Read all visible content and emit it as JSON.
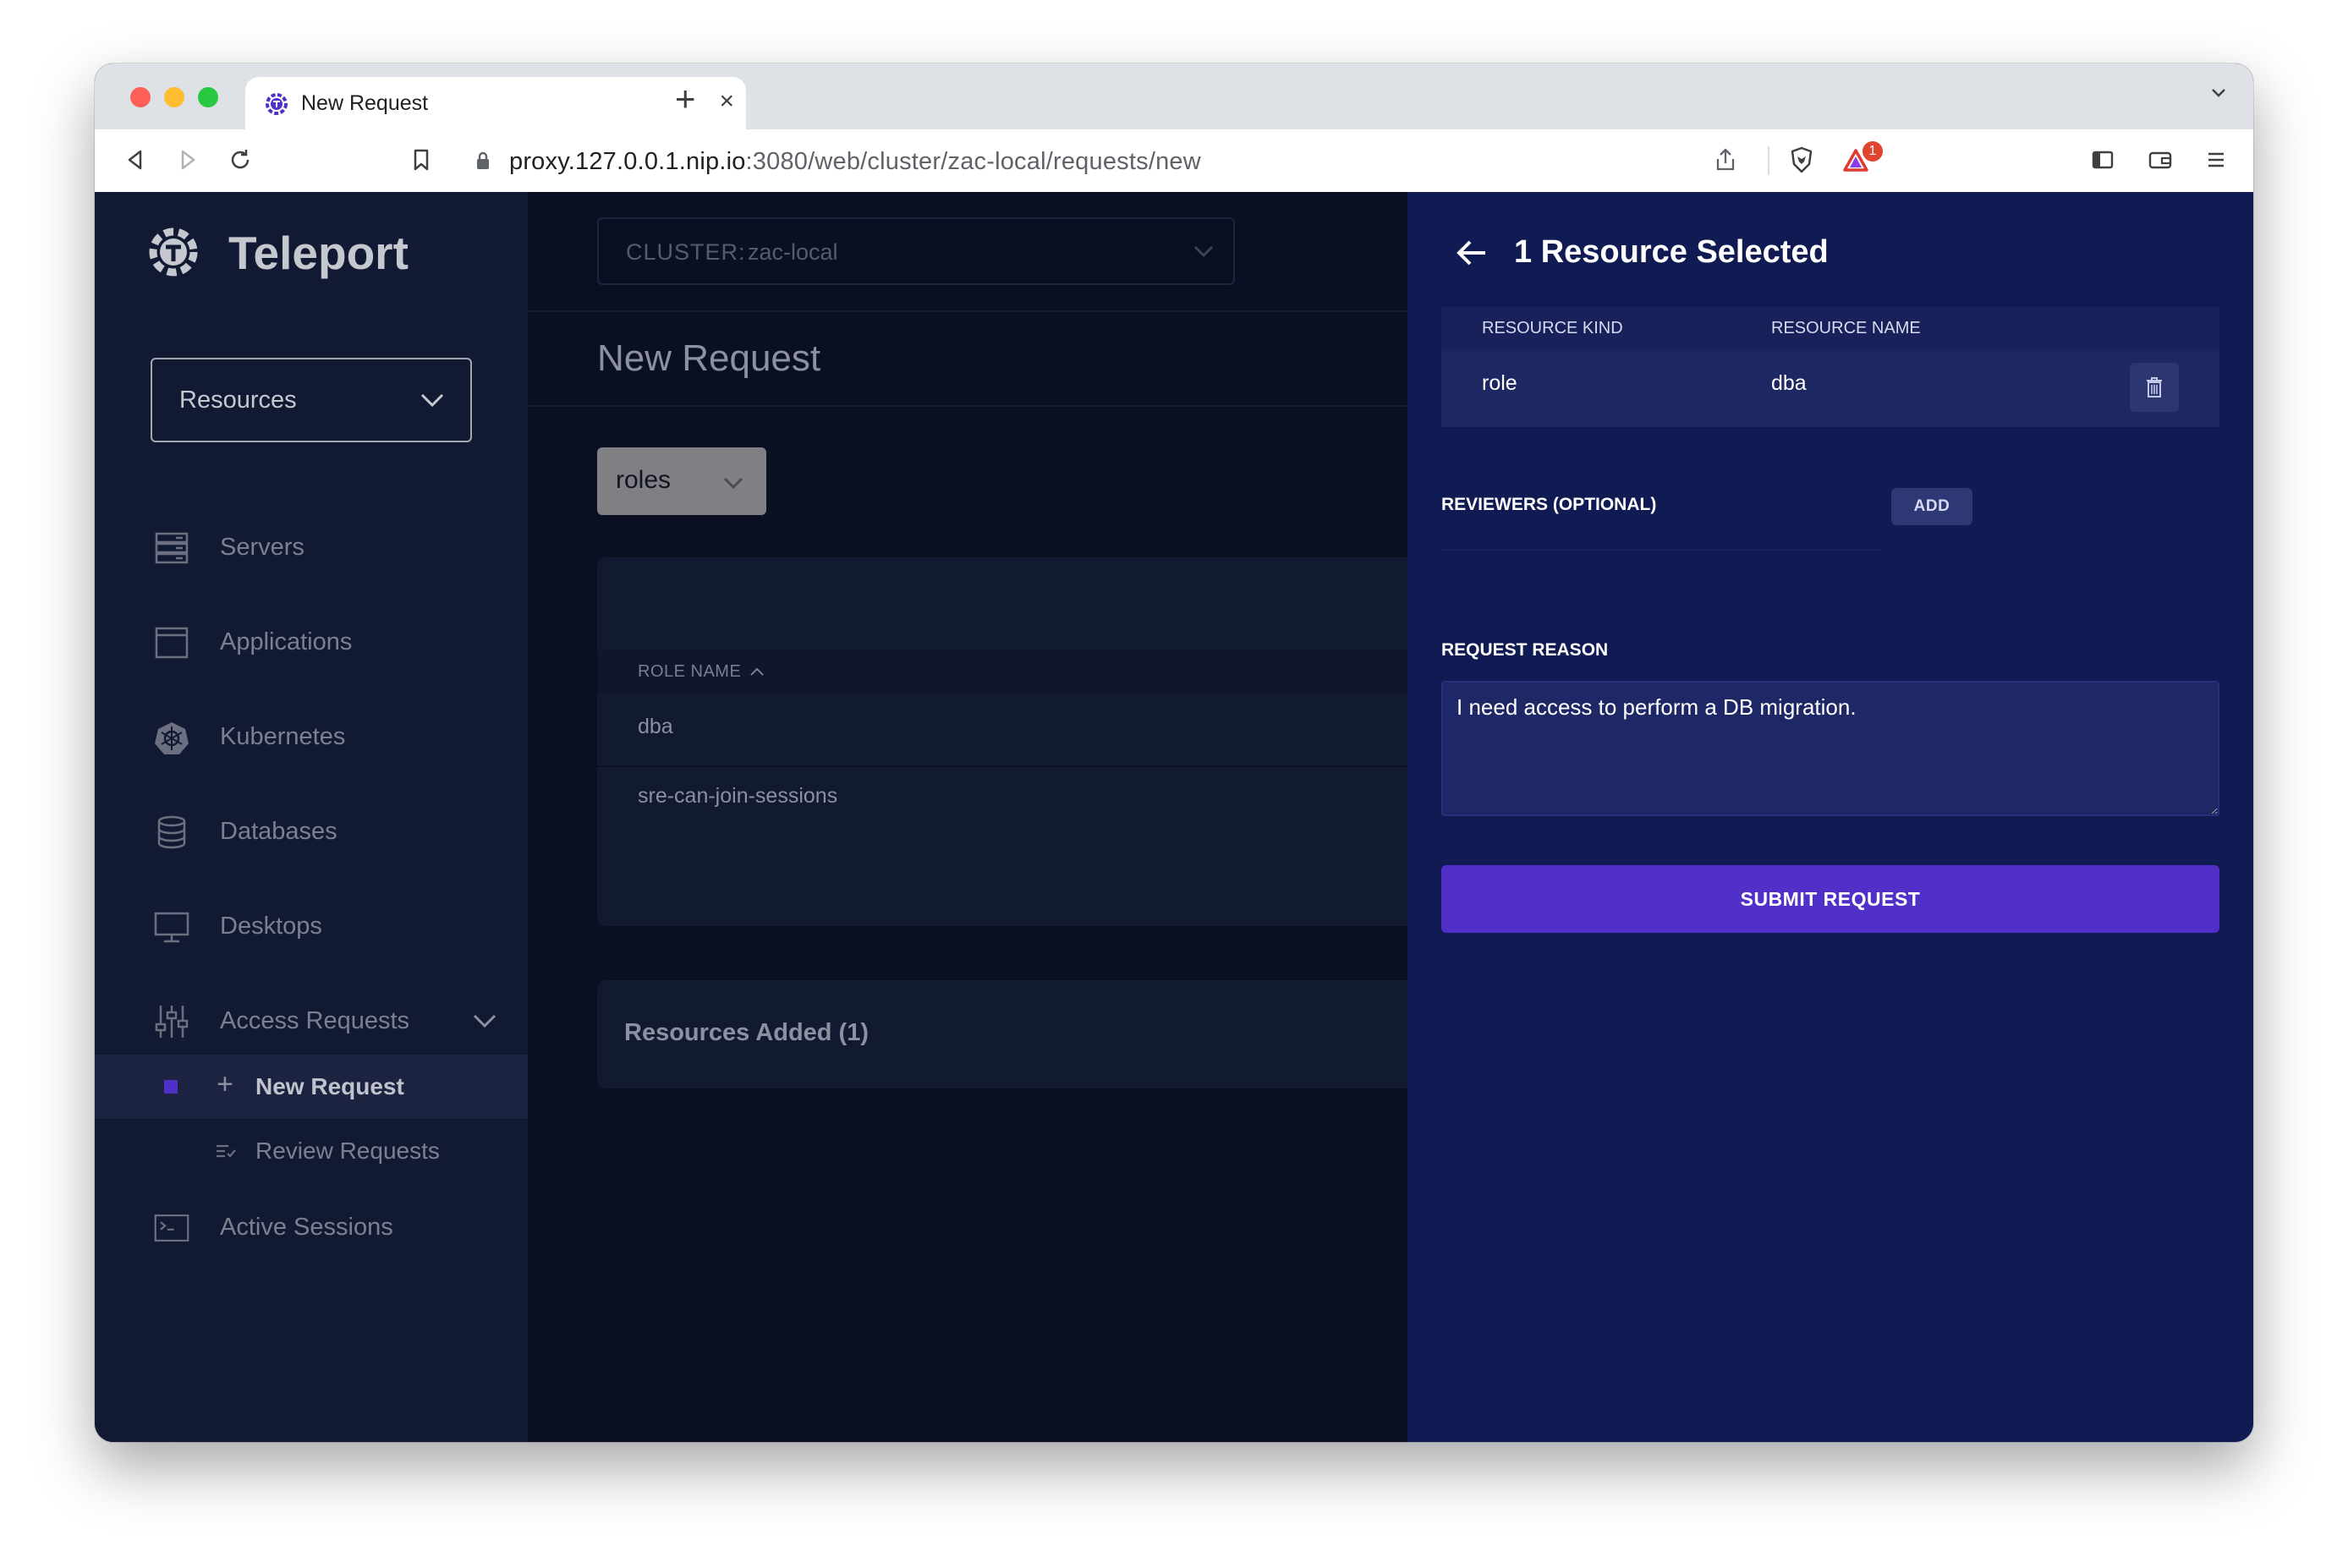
{
  "browser": {
    "tab_title": "New Request",
    "url_host": "proxy.127.0.0.1.nip.io",
    "url_path": ":3080/web/cluster/zac-local/requests/new",
    "brave_alert_count": "1"
  },
  "sidebar": {
    "logo": "Teleport",
    "resources_select": "Resources",
    "items": {
      "servers": "Servers",
      "applications": "Applications",
      "kubernetes": "Kubernetes",
      "databases": "Databases",
      "desktops": "Desktops",
      "access_requests": "Access Requests",
      "new_request": "New Request",
      "review_requests": "Review Requests",
      "active_sessions": "Active Sessions"
    }
  },
  "main": {
    "cluster_label": "CLUSTER:",
    "cluster_value": "zac-local",
    "page_title": "New Request",
    "resource_type": "roles",
    "table": {
      "column": "ROLE NAME",
      "rows": [
        "dba",
        "sre-can-join-sessions"
      ]
    },
    "resources_added": "Resources Added (1)"
  },
  "panel": {
    "title": "1 Resource Selected",
    "columns": {
      "kind": "RESOURCE KIND",
      "name": "RESOURCE NAME"
    },
    "row": {
      "kind": "role",
      "name": "dba"
    },
    "reviewers_label": "REVIEWERS (OPTIONAL)",
    "add_button": "ADD",
    "reason_label": "REQUEST REASON",
    "reason_value": "I need access to perform a DB migration.",
    "submit_button": "SUBMIT REQUEST"
  },
  "colors": {
    "accent": "#512fc9",
    "panel_bg": "#111b53",
    "sidebar_bg": "#121a33"
  }
}
